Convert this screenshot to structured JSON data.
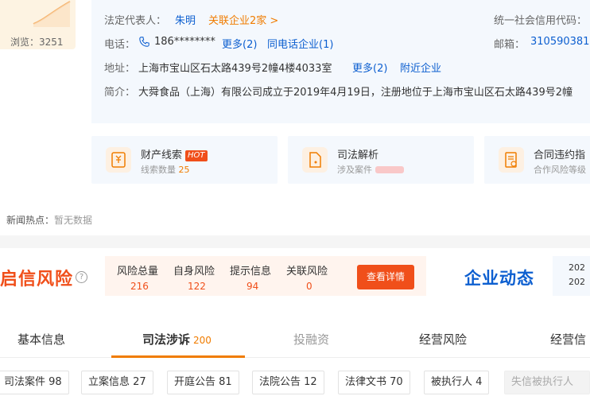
{
  "profile": {
    "views_label": "浏览：3251",
    "legal_rep_label": "法定代表人：",
    "legal_rep_name": "朱明",
    "related_companies": "关联企业2家 >",
    "credit_code_label": "统一社会信用代码：",
    "phone_label": "电话：",
    "phone_value": "186********",
    "phone_more": "更多(2)",
    "same_phone": "同电话企业(1)",
    "postcode_label": "邮箱：",
    "postcode_value": "310590381",
    "address_label": "地址：",
    "address_value": "上海市宝山区石太路439号2幢4楼4033室",
    "address_more": "更多(2)",
    "nearby": "附近企业",
    "intro_label": "简介：",
    "intro_value": "大舜食品（上海）有限公司成立于2019年4月19日，注册地位于上海市宝山区石太路439号2幢"
  },
  "features": [
    {
      "title": "财产线索",
      "hot": "HOT",
      "sub_label": "线索数量",
      "sub_value": "25",
      "icon": "money-document-icon"
    },
    {
      "title": "司法解析",
      "sub_label": "涉及案件",
      "icon": "court-document-icon"
    },
    {
      "title": "合同违约指",
      "sub_label": "合作风险等级",
      "icon": "contract-icon"
    }
  ],
  "news": {
    "label": "新闻热点：",
    "value": "暂无数据"
  },
  "risk": {
    "title": "启信风险",
    "stats": [
      {
        "label": "风险总量",
        "value": "216"
      },
      {
        "label": "自身风险",
        "value": "122"
      },
      {
        "label": "提示信息",
        "value": "94"
      },
      {
        "label": "关联风险",
        "value": "0"
      }
    ],
    "detail_button": "查看详情"
  },
  "dynamics": {
    "title": "企业动态",
    "year1": "202",
    "year2": "202"
  },
  "tabs": [
    {
      "label": "基本信息",
      "count": ""
    },
    {
      "label": "司法涉诉",
      "count": "200"
    },
    {
      "label": "投融资",
      "count": ""
    },
    {
      "label": "经营风险",
      "count": ""
    },
    {
      "label": "经营信",
      "count": ""
    }
  ],
  "chips": [
    "司法案件 98",
    "立案信息 27",
    "开庭公告 81",
    "法院公告 12",
    "法律文书 70",
    "被执行人 4",
    "失信被执行人"
  ],
  "colors": {
    "accent": "#f07c00",
    "link": "#0d5fd0",
    "risk": "#f04f1a",
    "card_bg": "#f4f8fd"
  }
}
